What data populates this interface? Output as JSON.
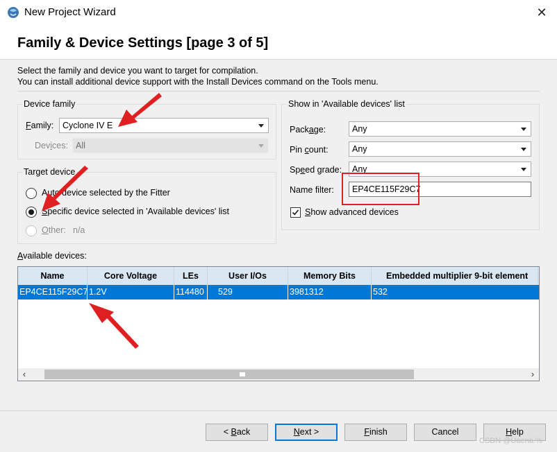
{
  "window": {
    "title": "New Project Wizard",
    "close_glyph": "✕"
  },
  "header": {
    "title": "Family & Device Settings [page 3 of 5]"
  },
  "description": {
    "line1": "Select the family and device you want to target for compilation.",
    "line2": "You can install additional device support with the Install Devices command on the Tools menu."
  },
  "device_family": {
    "group_label": "Device family",
    "family_label_hotkey": "F",
    "family_label_rest": "amily:",
    "family_value": "Cyclone IV E",
    "devices_label_pre": "Dev",
    "devices_label_hotkey": "i",
    "devices_label_post": "ces:",
    "devices_value": "All"
  },
  "target_device": {
    "group_label": "Target device",
    "option_auto": "Auto device selected by the Fitter",
    "option_specific_hotkey": "S",
    "option_specific_rest": "pecific device selected in 'Available devices' list",
    "option_other_hotkey": "O",
    "option_other_rest": "ther:",
    "option_other_value": "n/a",
    "selected": "specific"
  },
  "show_in": {
    "group_label": "Show in 'Available devices' list",
    "package_label_pre": "Pack",
    "package_label_hotkey": "a",
    "package_label_post": "ge:",
    "package_value": "Any",
    "pin_count_label_pre": "Pin ",
    "pin_count_label_hotkey": "c",
    "pin_count_label_post": "ount:",
    "pin_count_value": "Any",
    "speed_grade_label_pre": "Sp",
    "speed_grade_label_hotkey": "e",
    "speed_grade_label_post": "ed grade:",
    "speed_grade_value": "Any",
    "name_filter_label": "Name filter:",
    "name_filter_value": "EP4CE115F29C7",
    "show_advanced_hotkey": "S",
    "show_advanced_rest": "how advanced devices",
    "show_advanced_checked": true
  },
  "available_devices": {
    "label_hotkey": "A",
    "label_rest": "vailable devices:",
    "columns": [
      "Name",
      "Core Voltage",
      "LEs",
      "User I/Os",
      "Memory Bits",
      "Embedded multiplier 9-bit element"
    ],
    "rows": [
      {
        "name": "EP4CE115F29C7",
        "core_voltage": "1.2V",
        "les": "114480",
        "user_ios": "529",
        "memory_bits": "3981312",
        "multipliers": "532"
      }
    ],
    "selected_row": 0
  },
  "buttons": {
    "back_prefix": "< ",
    "back_hotkey": "B",
    "back_rest": "ack",
    "next_hotkey": "N",
    "next_rest": "ext >",
    "finish_hotkey": "F",
    "finish_rest": "inish",
    "cancel": "Cancel",
    "help_hotkey": "H",
    "help_rest": "elp"
  },
  "watermark": "CSDN @Uaena.%",
  "colors": {
    "selection": "#0078d7",
    "header_bg": "#d9e7f3",
    "annotation_red": "#e02020"
  },
  "icons": {
    "app": "quartus-app-icon",
    "close": "close-icon",
    "dropdown": "chevron-down-icon",
    "check": "check-icon",
    "scroll_left": "chevron-left-icon",
    "scroll_right": "chevron-right-icon"
  }
}
